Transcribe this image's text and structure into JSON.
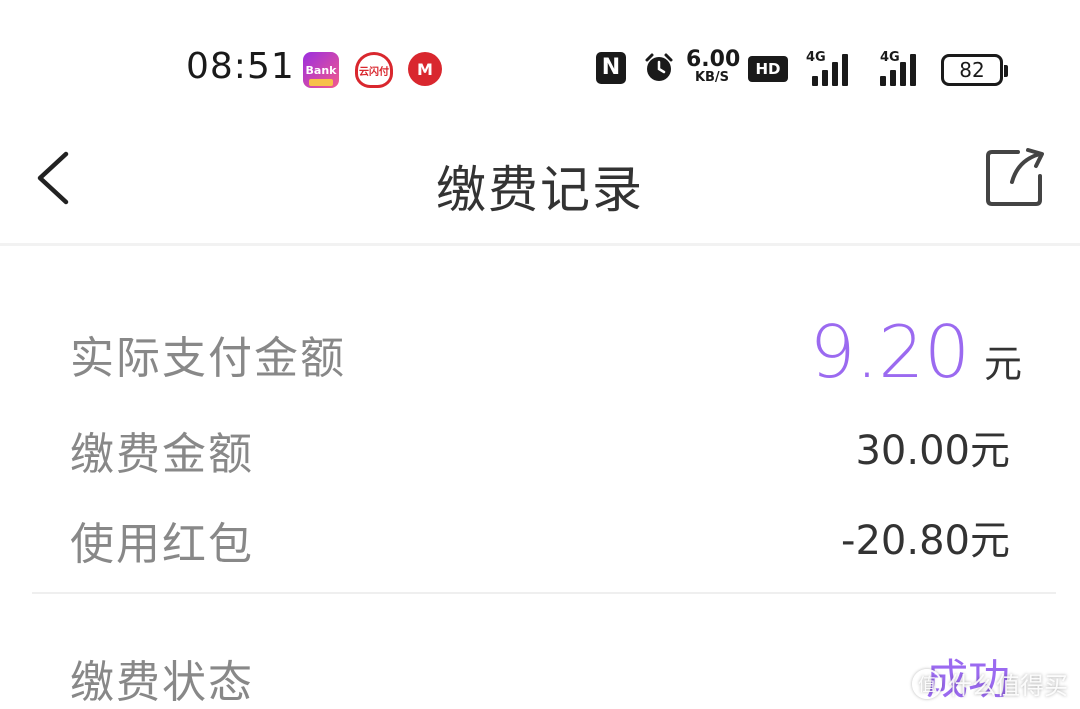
{
  "status_bar": {
    "time": "08:51",
    "apps": [
      {
        "name": "bank-app-icon",
        "label": "Bank"
      },
      {
        "name": "yunshanfu-app-icon",
        "label": "云闪付"
      },
      {
        "name": "cmb-app-icon",
        "label": "M"
      }
    ],
    "nfc": "N",
    "net_speed_value": "6.00",
    "net_speed_unit": "KB/S",
    "hd": "HD",
    "signal1_label": "4G",
    "signal2_label": "4G",
    "battery": "82"
  },
  "nav": {
    "title": "缴费记录"
  },
  "payment": {
    "actual_label": "实际支付金额",
    "actual_amount": "9.20",
    "actual_unit": "元",
    "fee_label": "缴费金额",
    "fee_value": "30.00元",
    "redpack_label": "使用红包",
    "redpack_value": "-20.80元",
    "status_label": "缴费状态",
    "status_value": "成功"
  },
  "watermark": {
    "text": "什么值得买",
    "icon": "值"
  },
  "colors": {
    "accent": "#9b6af0",
    "text": "#333333",
    "label": "#888888"
  }
}
